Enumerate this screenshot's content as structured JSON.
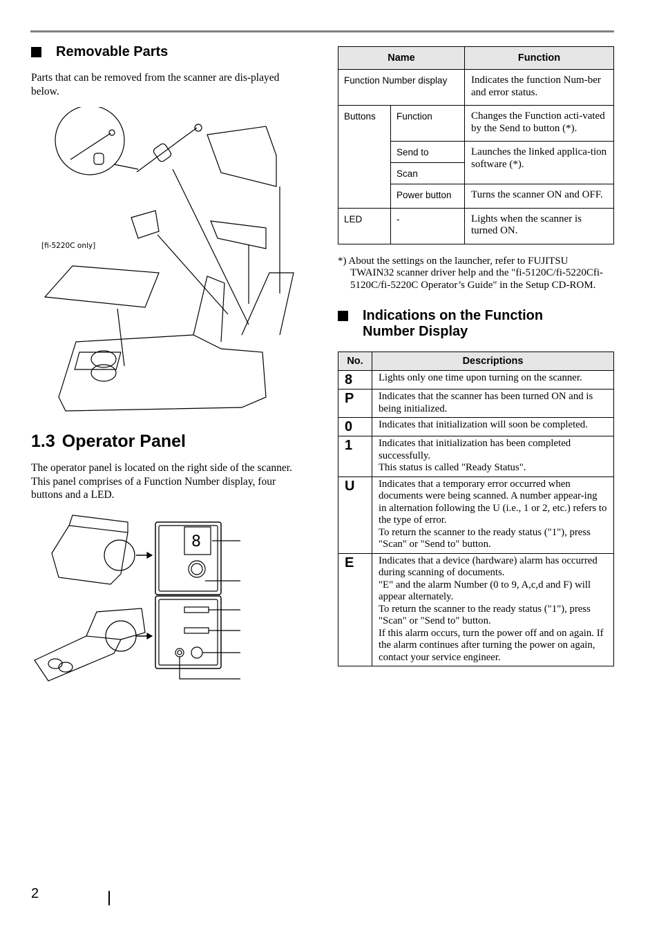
{
  "left_column": {
    "removable_parts": {
      "heading": "Removable Parts",
      "intro": "Parts that can be removed from the scanner are dis-played below.",
      "figure_label": "[fi-5220C only]"
    },
    "operator_panel": {
      "section_number": "1.3",
      "heading": "Operator Panel",
      "intro": "The operator panel is located on the right side of the scanner. This panel comprises  of a Function Number display, four buttons and a LED."
    }
  },
  "right_column": {
    "panel_table": {
      "headers": [
        "Name",
        "Function"
      ],
      "rows": [
        {
          "name": "Function Number display",
          "function": "Indicates the function Num-ber and error status."
        },
        {
          "group": "Buttons",
          "name": "Function",
          "function": "Changes the Function acti-vated by the Send to button (*)."
        },
        {
          "name": "Send to",
          "function": "Launches the linked applica-tion software (*)."
        },
        {
          "name": "Scan"
        },
        {
          "name": "Power button",
          "function": "Turns the scanner ON and OFF."
        },
        {
          "group": "LED",
          "name": "-",
          "function": "Lights when the scanner is turned ON."
        }
      ]
    },
    "footnote": "*) About the settings on the launcher, refer to FUJITSU TWAIN32 scanner driver help and the \"fi-5120C/fi-5220Cfi-5120C/fi-5220C Operator’s Guide\" in the Setup CD-ROM.",
    "indications": {
      "heading_line1": "Indications on the Function",
      "heading_line2": "Number Display",
      "headers": [
        "No.",
        "Descriptions"
      ],
      "rows": [
        {
          "no": "8",
          "lines": [
            "Lights only one time upon turning on the scanner."
          ]
        },
        {
          "no": "P",
          "lines": [
            "Indicates that the scanner has been turned ON and is being initialized."
          ]
        },
        {
          "no": "0",
          "lines": [
            "Indicates that initialization will soon be completed."
          ]
        },
        {
          "no": "1",
          "lines": [
            "Indicates that initialization has been completed successfully.",
            "This status is called \"Ready Status\"."
          ]
        },
        {
          "no": "U",
          "lines": [
            "Indicates that a temporary error occurred when documents were being scanned. A number appear-ing in alternation following the U  (i.e., 1 or 2, etc.) refers to the type of error.",
            "To return the scanner to the ready status (\"1\"), press \"Scan\" or \"Send to\" button."
          ]
        },
        {
          "no": "E",
          "lines": [
            "Indicates that a device (hardware) alarm has occurred during scanning of documents.",
            "\"E\" and the alarm Number (0 to 9, A,c,d and F) will appear alternately.",
            "To return the scanner to the ready status (\"1\"), press \"Scan\" or \"Send to\" button.",
            "If this alarm occurs, turn the power off and on again. If the alarm continues after turning the power on again, contact your service engineer."
          ]
        }
      ]
    }
  },
  "footer": {
    "page_number": "2"
  }
}
